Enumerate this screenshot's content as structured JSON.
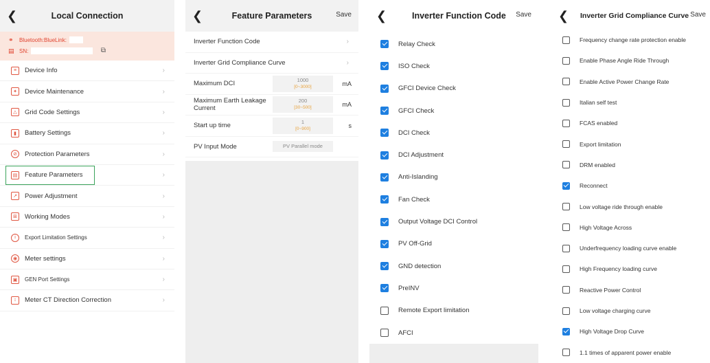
{
  "local_connection": {
    "title": "Local Connection",
    "bluetooth_label": "Bluetooth:BlueLink:",
    "sn_label": "SN:",
    "menu": [
      {
        "label": "Device Info",
        "icon": "document-icon"
      },
      {
        "label": "Device Maintenance",
        "icon": "wrench-icon"
      },
      {
        "label": "Grid Code Settings",
        "icon": "grid-tower-icon"
      },
      {
        "label": "Battery Settings",
        "icon": "battery-icon"
      },
      {
        "label": "Protection Parameters",
        "icon": "shield-icon"
      },
      {
        "label": "Feature Parameters",
        "icon": "feature-icon"
      },
      {
        "label": "Power Adjustment",
        "icon": "power-adjust-icon"
      },
      {
        "label": "Working Modes",
        "icon": "mode-icon"
      },
      {
        "label": "Export Limitation Settings",
        "icon": "info-icon"
      },
      {
        "label": "Meter settings",
        "icon": "meter-icon"
      },
      {
        "label": "GEN Port Settings",
        "icon": "port-icon"
      },
      {
        "label": "Meter CT Direction Correction",
        "icon": "ct-icon"
      }
    ],
    "highlighted_item": "Feature Parameters",
    "highlight_color": "#3aa35a",
    "accent_color": "#e05540"
  },
  "feature_parameters": {
    "title": "Feature Parameters",
    "save_label": "Save",
    "nav_rows": [
      {
        "label": "Inverter Function Code"
      },
      {
        "label": "Inverter Grid Compliance Curve"
      }
    ],
    "fields": [
      {
        "label": "Maximum DCI",
        "value": "1000",
        "range": "[0~3000]",
        "unit": "mA"
      },
      {
        "label": "Maximum Earth Leakage Current",
        "value": "200",
        "range": "[30~500]",
        "unit": "mA"
      },
      {
        "label": "Start up time",
        "value": "1",
        "range": "[0~900]",
        "unit": "s"
      }
    ],
    "pv_mode": {
      "label": "PV Input Mode",
      "value": "PV Parallel mode"
    }
  },
  "inverter_function_code": {
    "title": "Inverter Function Code",
    "save_label": "Save",
    "items": [
      {
        "label": "Relay Check",
        "checked": true
      },
      {
        "label": "ISO Check",
        "checked": true
      },
      {
        "label": "GFCI Device Check",
        "checked": true
      },
      {
        "label": "GFCI Check",
        "checked": true
      },
      {
        "label": "DCI Check",
        "checked": true
      },
      {
        "label": "DCI Adjustment",
        "checked": true
      },
      {
        "label": "Anti-Islanding",
        "checked": true
      },
      {
        "label": "Fan Check",
        "checked": true
      },
      {
        "label": "Output Voltage DCI Control",
        "checked": true
      },
      {
        "label": "PV Off-Grid",
        "checked": true
      },
      {
        "label": "GND detection",
        "checked": true
      },
      {
        "label": "PreINV",
        "checked": true
      },
      {
        "label": "Remote Export limitation",
        "checked": false
      },
      {
        "label": "AFCI",
        "checked": false
      }
    ],
    "check_color": "#1e7fe0"
  },
  "grid_compliance_curve": {
    "title": "Inverter Grid Compliance Curve",
    "save_label": "Save",
    "items": [
      {
        "label": "Frequency change rate protection enable",
        "checked": false
      },
      {
        "label": "Enable Phase Angle Ride Through",
        "checked": false
      },
      {
        "label": "Enable Active Power Change Rate",
        "checked": false
      },
      {
        "label": "Italian self test",
        "checked": false
      },
      {
        "label": "FCAS enabled",
        "checked": false
      },
      {
        "label": "Export limitation",
        "checked": false
      },
      {
        "label": "DRM enabled",
        "checked": false
      },
      {
        "label": "Reconnect",
        "checked": true
      },
      {
        "label": "Low voltage ride through enable",
        "checked": false
      },
      {
        "label": "High Voltage Across",
        "checked": false
      },
      {
        "label": "Underfrequency loading curve enable",
        "checked": false
      },
      {
        "label": "High Frequency loading curve",
        "checked": false
      },
      {
        "label": "Reactive Power Control",
        "checked": false
      },
      {
        "label": "Low voltage charging curve",
        "checked": false
      },
      {
        "label": "High Voltage Drop Curve",
        "checked": true
      },
      {
        "label": "1.1 times of apparent power enable",
        "checked": false
      }
    ]
  }
}
